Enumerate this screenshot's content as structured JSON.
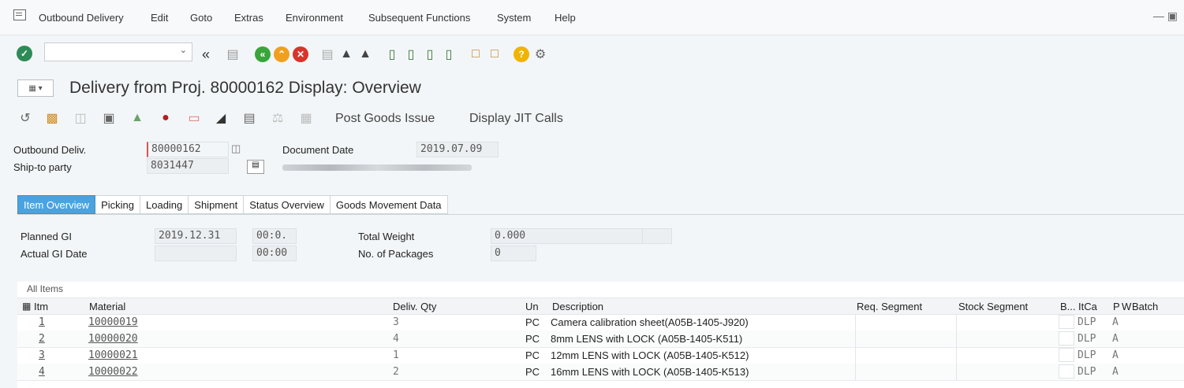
{
  "menu": {
    "items": [
      "Outbound Delivery",
      "Edit",
      "Goto",
      "Extras",
      "Environment",
      "Subsequent Functions",
      "System",
      "Help"
    ]
  },
  "title": "Delivery from Proj. 80000162 Display: Overview",
  "app_toolbar": {
    "post_goods_issue": "Post Goods Issue",
    "display_jit_calls": "Display JIT Calls"
  },
  "header": {
    "outbound_deliv_label": "Outbound Deliv.",
    "outbound_deliv_value": "80000162",
    "document_date_label": "Document Date",
    "document_date_value": "2019.07.09",
    "ship_to_label": "Ship-to party",
    "ship_to_value": "8031447"
  },
  "tabs": [
    "Item Overview",
    "Picking",
    "Loading",
    "Shipment",
    "Status Overview",
    "Goods Movement Data"
  ],
  "item_overview": {
    "planned_gi_label": "Planned GI",
    "planned_gi_date": "2019.12.31",
    "planned_gi_time": "00:0.",
    "actual_gi_label": "Actual GI Date",
    "actual_gi_time": "00:00",
    "total_weight_label": "Total Weight",
    "total_weight_value": "0.000",
    "packages_label": "No. of Packages",
    "packages_value": "0"
  },
  "table": {
    "caption": "All Items",
    "columns": {
      "itm": "Itm",
      "material": "Material",
      "deliv_qty": "Deliv. Qty",
      "un": "Un",
      "description": "Description",
      "req_segment": "Req. Segment",
      "stock_segment": "Stock Segment",
      "b": "B...",
      "itca": "ItCa",
      "p": "P",
      "w": "W",
      "batch": "Batch"
    },
    "rows": [
      {
        "itm": "1",
        "material": "10000019",
        "qty": "3",
        "un": "PC",
        "desc": "Camera calibration sheet(A05B-1405-J920)",
        "itca": "DLP",
        "p": "A"
      },
      {
        "itm": "2",
        "material": "10000020",
        "qty": "4",
        "un": "PC",
        "desc": "8mm LENS with LOCK (A05B-1405-K511)",
        "itca": "DLP",
        "p": "A"
      },
      {
        "itm": "3",
        "material": "10000021",
        "qty": "1",
        "un": "PC",
        "desc": "12mm LENS with LOCK (A05B-1405-K512)",
        "itca": "DLP",
        "p": "A"
      },
      {
        "itm": "4",
        "material": "10000022",
        "qty": "2",
        "un": "PC",
        "desc": "16mm LENS with LOCK (A05B-1405-K513)",
        "itca": "DLP",
        "p": "A"
      }
    ]
  },
  "colors": {
    "active_tab": "#4aa3df",
    "enter_green": "#2e8b57",
    "nav_green": "#3aa53a",
    "nav_orange": "#f0a020",
    "nav_red": "#d9342b",
    "help_yellow": "#f0b400"
  }
}
